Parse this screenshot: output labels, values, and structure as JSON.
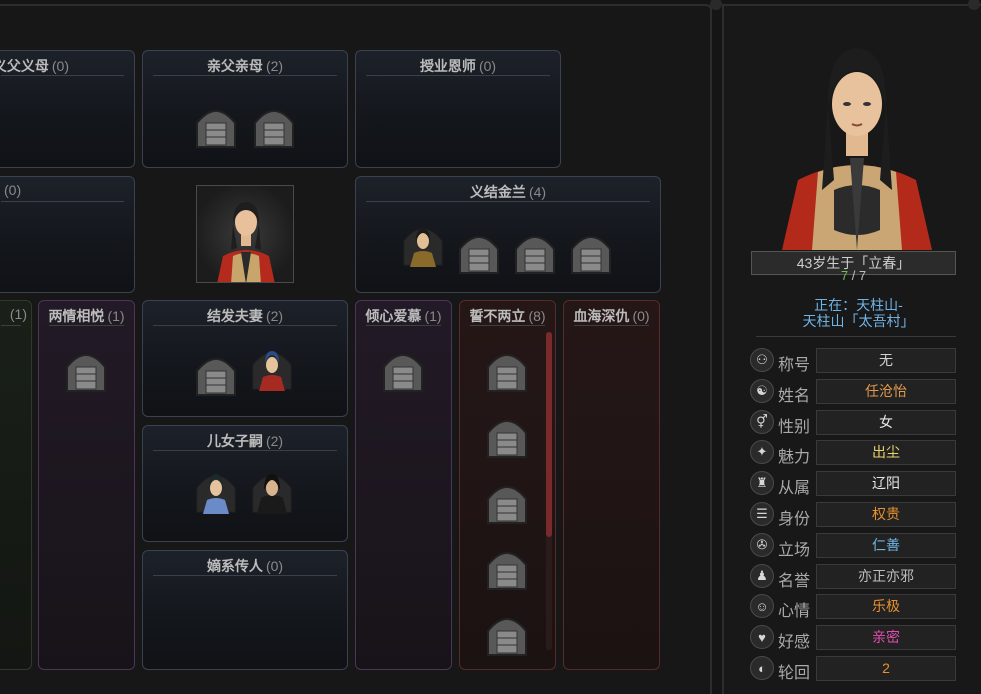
{
  "relations": {
    "adoptive_parents": {
      "title": "义父义母",
      "count": "(0)"
    },
    "birth_parents": {
      "title": "亲父亲母",
      "count": "(2)"
    },
    "master": {
      "title": "授业恩师",
      "count": "(0)"
    },
    "left_mid": {
      "title": "",
      "count": "(0)"
    },
    "sworn": {
      "title": "义结金兰",
      "count": "(4)"
    },
    "left_bottom": {
      "title": "",
      "count": "(1)"
    },
    "mutual_love": {
      "title": "两情相悦",
      "count": "(1)"
    },
    "spouse": {
      "title": "结发夫妻",
      "count": "(2)"
    },
    "admire": {
      "title": "倾心爱慕",
      "count": "(1)"
    },
    "enemy": {
      "title": "誓不两立",
      "count": "(8)"
    },
    "blood_feud": {
      "title": "血海深仇",
      "count": "(0)"
    },
    "children": {
      "title": "儿女子嗣",
      "count": "(2)"
    },
    "heir": {
      "title": "嫡系传人",
      "count": "(0)"
    }
  },
  "character": {
    "age_birth": "43岁生于「立春」",
    "hp_current": "7",
    "hp_sep": " / ",
    "hp_max": "7",
    "location_line1": "正在：天柱山-",
    "location_line2": "天柱山「太吾村」"
  },
  "attributes": [
    {
      "icon": "title-icon",
      "glyph": "⚇",
      "label": "称号",
      "value": "无",
      "color": "#cfcfcf"
    },
    {
      "icon": "name-icon",
      "glyph": "☯",
      "label": "姓名",
      "value": "任沧怡",
      "color": "#e39a4f"
    },
    {
      "icon": "gender-icon",
      "glyph": "⚥",
      "label": "性别",
      "value": "女",
      "color": "#e8e8e8"
    },
    {
      "icon": "charm-icon",
      "glyph": "✦",
      "label": "魅力",
      "value": "出尘",
      "color": "#e8d36a"
    },
    {
      "icon": "affiliation-icon",
      "glyph": "♜",
      "label": "从属",
      "value": "辽阳",
      "color": "#e8e8e8"
    },
    {
      "icon": "status-icon",
      "glyph": "☰",
      "label": "身份",
      "value": "权贵",
      "color": "#e8902f"
    },
    {
      "icon": "stance-icon",
      "glyph": "✇",
      "label": "立场",
      "value": "仁善",
      "color": "#6fb4e6"
    },
    {
      "icon": "fame-icon",
      "glyph": "♟",
      "label": "名誉",
      "value": "亦正亦邪",
      "color": "#bdbdbd"
    },
    {
      "icon": "mood-icon",
      "glyph": "☺",
      "label": "心情",
      "value": "乐极",
      "color": "#e8902f"
    },
    {
      "icon": "favor-icon",
      "glyph": "♥",
      "label": "好感",
      "value": "亲密",
      "color": "#e04fb0"
    },
    {
      "icon": "samsara-icon",
      "glyph": "◐",
      "label": "轮回",
      "value": "2",
      "color": "#e8902f"
    }
  ]
}
